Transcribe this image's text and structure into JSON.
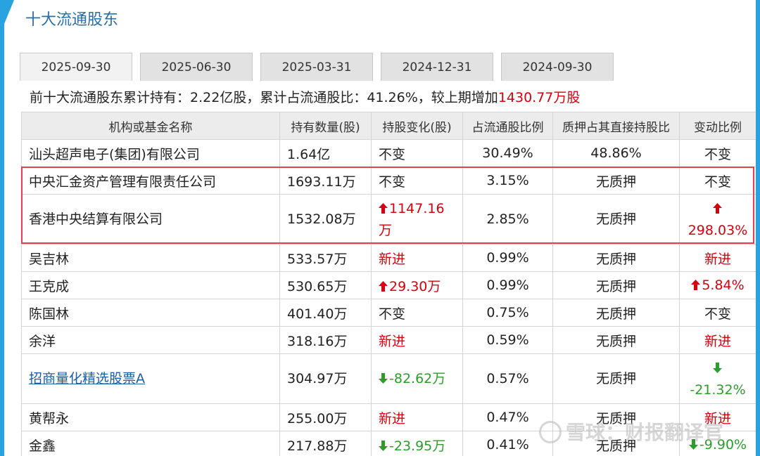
{
  "title": "十大流通股东",
  "tabs": [
    "2025-09-30",
    "2025-06-30",
    "2025-03-31",
    "2024-12-31",
    "2024-09-30"
  ],
  "active_tab": 0,
  "summary": {
    "prefix": "前十大流通股东累计持有：",
    "hold": "2.22亿股",
    "mid1": "，累计占流通股比：",
    "ratio": "41.26%",
    "mid2": "，较上期增加",
    "increase": "1430.77万股"
  },
  "headers": [
    "机构或基金名称",
    "持有数量(股)",
    "持股变化(股)",
    "占流通股比例",
    "质押占其直接持股比",
    "变动比例"
  ],
  "rows": [
    {
      "name": "汕头超声电子(集团)有限公司",
      "qty": "1.64亿",
      "change": "不变",
      "change_dir": "none",
      "ratio": "30.49%",
      "pledge": "48.86%",
      "pct": "不变",
      "pct_dir": "none"
    },
    {
      "name": "中央汇金资产管理有限责任公司",
      "qty": "1693.11万",
      "change": "不变",
      "change_dir": "none",
      "ratio": "3.15%",
      "pledge": "无质押",
      "pct": "不变",
      "pct_dir": "none"
    },
    {
      "name": "香港中央结算有限公司",
      "qty": "1532.08万",
      "change": "1147.16万",
      "change_dir": "up",
      "ratio": "2.85%",
      "pledge": "无质押",
      "pct": "298.03%",
      "pct_dir": "up"
    },
    {
      "name": "吴吉林",
      "qty": "533.57万",
      "change": "新进",
      "change_dir": "new",
      "ratio": "0.99%",
      "pledge": "无质押",
      "pct": "新进",
      "pct_dir": "new"
    },
    {
      "name": "王克成",
      "qty": "530.65万",
      "change": "29.30万",
      "change_dir": "up",
      "ratio": "0.99%",
      "pledge": "无质押",
      "pct": "5.84%",
      "pct_dir": "up"
    },
    {
      "name": "陈国林",
      "qty": "401.40万",
      "change": "不变",
      "change_dir": "none",
      "ratio": "0.75%",
      "pledge": "无质押",
      "pct": "不变",
      "pct_dir": "none"
    },
    {
      "name": "余洋",
      "qty": "318.16万",
      "change": "新进",
      "change_dir": "new",
      "ratio": "0.59%",
      "pledge": "无质押",
      "pct": "新进",
      "pct_dir": "new"
    },
    {
      "name": "招商量化精选股票A",
      "qty": "304.97万",
      "change": "-82.62万",
      "change_dir": "down",
      "ratio": "0.57%",
      "pledge": "无质押",
      "pct": "-21.32%",
      "pct_dir": "down",
      "link": true
    },
    {
      "name": "黄帮永",
      "qty": "255.00万",
      "change": "新进",
      "change_dir": "new",
      "ratio": "0.47%",
      "pledge": "无质押",
      "pct": "新进",
      "pct_dir": "new"
    },
    {
      "name": "金鑫",
      "qty": "217.88万",
      "change": "-23.95万",
      "change_dir": "down",
      "ratio": "0.41%",
      "pledge": "无质押",
      "pct": "-9.90%",
      "pct_dir": "down"
    }
  ],
  "watermark": "雪球：财报翻译官",
  "colors": {
    "up": "#d6000f",
    "down": "#2c9c2c",
    "accent": "#29a3e0",
    "highlight": "#e0434b"
  }
}
